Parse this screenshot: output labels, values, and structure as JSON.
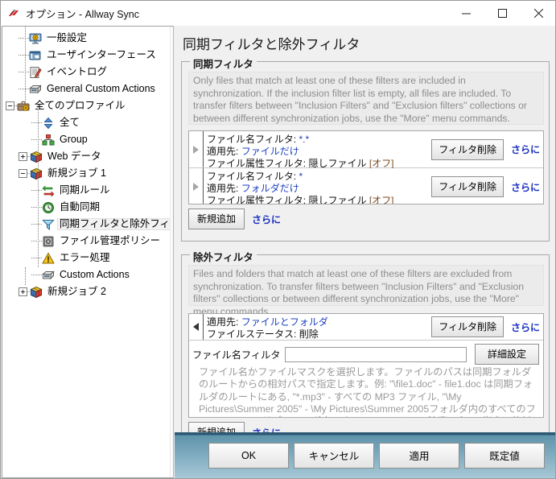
{
  "window": {
    "title": "オプション - Allway Sync",
    "app_icon": "allway-sync-logo-icon",
    "minimize_label": "−",
    "maximize_label": "□",
    "close_label": "✕"
  },
  "sidebar": {
    "items": [
      {
        "label": "一般設定",
        "icon": "monitor-gear-icon",
        "depth": 1,
        "expander": "none",
        "selected": false
      },
      {
        "label": "ユーザインターフェース",
        "icon": "window-ui-icon",
        "depth": 1,
        "expander": "none",
        "selected": false
      },
      {
        "label": "イベントログ",
        "icon": "notepad-pencil-icon",
        "depth": 1,
        "expander": "none",
        "selected": false
      },
      {
        "label": "General Custom Actions",
        "icon": "drawer-actions-icon",
        "depth": 1,
        "expander": "none",
        "selected": false
      },
      {
        "label": "全てのプロファイル",
        "icon": "briefcase-gear-icon",
        "depth": 0,
        "expander": "collapse",
        "selected": false
      },
      {
        "label": "全て",
        "icon": "blue-double-arrow-icon",
        "depth": 2,
        "expander": "none",
        "selected": false
      },
      {
        "label": "Group",
        "icon": "group-nodes-icon",
        "depth": 2,
        "expander": "none",
        "selected": false
      },
      {
        "label": "Web データ",
        "icon": "rubik-cube-icon",
        "depth": 1,
        "expander": "expand",
        "selected": false
      },
      {
        "label": "新規ジョブ 1",
        "icon": "rubik-cube-icon",
        "depth": 1,
        "expander": "collapse",
        "selected": false
      },
      {
        "label": "同期ルール",
        "icon": "sync-arrows-icon",
        "depth": 2,
        "expander": "none",
        "selected": false
      },
      {
        "label": "自動同期",
        "icon": "clock-green-icon",
        "depth": 2,
        "expander": "none",
        "selected": false
      },
      {
        "label": "同期フィルタと除外フィルタ",
        "icon": "funnel-filter-icon",
        "depth": 2,
        "expander": "none",
        "selected": true
      },
      {
        "label": "ファイル管理ポリシー",
        "icon": "safe-box-icon",
        "depth": 2,
        "expander": "none",
        "selected": false
      },
      {
        "label": "エラー処理",
        "icon": "warning-triangle-icon",
        "depth": 2,
        "expander": "none",
        "selected": false
      },
      {
        "label": "Custom Actions",
        "icon": "drawer-actions-icon",
        "depth": 2,
        "expander": "none",
        "selected": false
      },
      {
        "label": "新規ジョブ 2",
        "icon": "rubik-cube-icon",
        "depth": 1,
        "expander": "expand",
        "selected": false
      }
    ]
  },
  "main": {
    "page_title": "同期フィルタと除外フィルタ",
    "inclusion": {
      "group_title": "同期フィルタ",
      "description": "Only files that match at least one of these filters are included in synchronization. If the inclusion filter list is empty, all files are included. To transfer filters between \"Inclusion Filters\" and \"Exclusion filters\" collections or between different synchronization jobs, use the \"More\" menu commands.",
      "filters": [
        {
          "expander_icon": "triangle-right-icon",
          "line1_label": "ファイル名フィルタ:",
          "line1_value": "*.*",
          "line2_label": "適用先:",
          "line2_value": "ファイルだけ",
          "line3_label": "ファイル属性フィルタ:",
          "line3_value": "隠しファイル",
          "line3_value2": "[オフ]",
          "delete_label": "フィルタ削除",
          "more_label": "さらに"
        },
        {
          "expander_icon": "triangle-right-icon",
          "line1_label": "ファイル名フィルタ:",
          "line1_value": "*",
          "line2_label": "適用先:",
          "line2_value": "フォルダだけ",
          "line3_label": "ファイル属性フィルタ:",
          "line3_value": "隠しファイル",
          "line3_value2": "[オフ]",
          "delete_label": "フィルタ削除",
          "more_label": "さらに"
        }
      ],
      "add_label": "新規追加",
      "more_label": "さらに"
    },
    "exclusion": {
      "group_title": "除外フィルタ",
      "description": "Files and folders that match at least one of these filters are excluded from synchronization. To transfer filters between \"Inclusion Filters\" and \"Exclusion filters\" collections or between different synchronization jobs, use the \"More\" menu commands.",
      "filter": {
        "expander_icon": "triangle-left-icon",
        "line1_label": "適用先:",
        "line1_value": "ファイルとフォルダ",
        "line2_label": "ファイルステータス:",
        "line2_value": "削除",
        "delete_label": "フィルタ削除",
        "more_label": "さらに"
      },
      "name_filter_label": "ファイル名フィルタ",
      "name_filter_value": "",
      "name_filter_placeholder": "",
      "advanced_label": "詳細設定",
      "help_text": "ファイル名かファイルマスクを選択します。ファイルのパスは同期フォルダのルートからの相対パスで指定します。例: \"\\file1.doc\" - file1.doc は同期フォルダのルートにある, \"*.mp3\" - すべての MP3 ファイル, \"\\My Pictures\\Summer 2005\" - \\My Pictures\\Summer 2005フォルダ内のすべてのファイル, \"\\*\\*\" - サブフォルダ内のすべてのファイル。注意: パスの指定に絶対パスは使用しないでください - 必ず同期フォルダのルートからの相対パスで指定してください。",
      "add_label": "新規追加",
      "more_label": "さらに"
    }
  },
  "footer": {
    "buttons": [
      {
        "label": "OK",
        "name": "ok-button"
      },
      {
        "label": "キャンセル",
        "name": "cancel-button"
      },
      {
        "label": "適用",
        "name": "apply-button"
      },
      {
        "label": "既定値",
        "name": "defaults-button"
      }
    ]
  },
  "colors": {
    "value_blue": "#1b3fbf",
    "link_blue": "#1a2fc0",
    "desc_gray": "#8d8d8d",
    "footer_blue": "#2b5873"
  }
}
